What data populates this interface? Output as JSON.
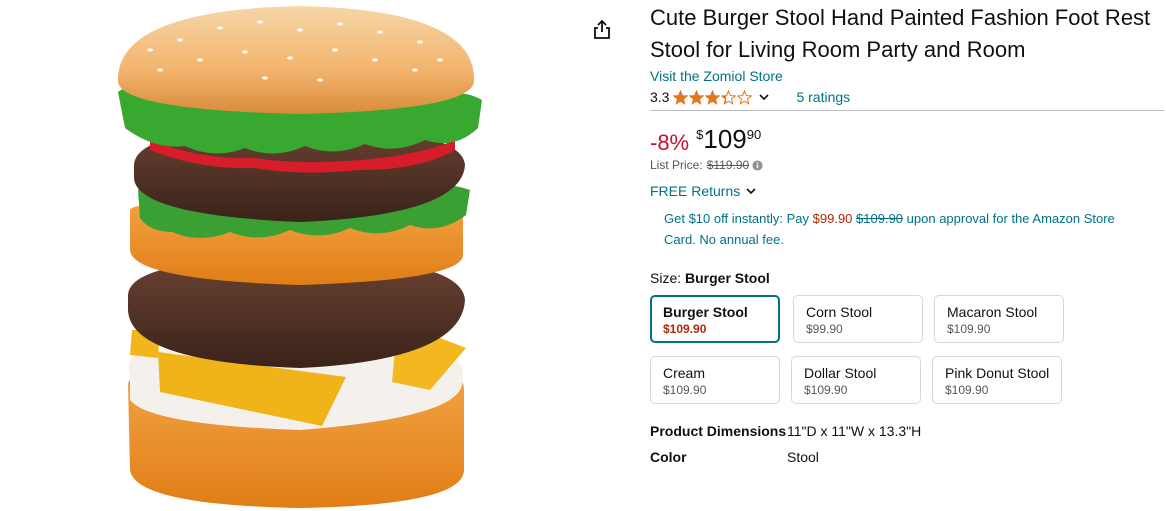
{
  "product": {
    "title": "Cute Burger Stool Hand Painted Fashion Foot Rest Stool for Living Room Party and Room",
    "store_link": "Visit the Zomiol Store",
    "rating_value": "3.3",
    "rating_stars": 3.3,
    "ratings_count": "5 ratings",
    "image_icon": "burger-stool-photo"
  },
  "price": {
    "discount": "-8%",
    "symbol": "$",
    "whole": "109",
    "fraction": "90",
    "list_price_label": "List Price:",
    "list_price": "$119.90"
  },
  "returns": {
    "label": "FREE Returns"
  },
  "card_offer": {
    "prefix": "Get $10 off instantly: Pay",
    "new_price": "$99.90",
    "old_price": "$109.90",
    "suffix": "upon approval for the Amazon Store Card. No annual fee."
  },
  "size": {
    "label": "Size:",
    "selected": "Burger Stool",
    "options": [
      {
        "name": "Burger Stool",
        "price": "$109.90",
        "selected": true
      },
      {
        "name": "Corn Stool",
        "price": "$99.90"
      },
      {
        "name": "Macaron Stool",
        "price": "$109.90"
      },
      {
        "name": "Cream",
        "price": "$109.90"
      },
      {
        "name": "Dollar Stool",
        "price": "$109.90"
      },
      {
        "name": "Pink Donut Stool",
        "price": "$109.90"
      }
    ]
  },
  "specs": [
    {
      "key": "Product Dimensions",
      "value": "11\"D x 11\"W x 13.3\"H"
    },
    {
      "key": "Color",
      "value": "Stool"
    }
  ],
  "colors": {
    "link": "#007185",
    "discount": "#cc0c39",
    "star": "#de7921",
    "selected_border": "#007185",
    "selected_price": "#b12704"
  }
}
